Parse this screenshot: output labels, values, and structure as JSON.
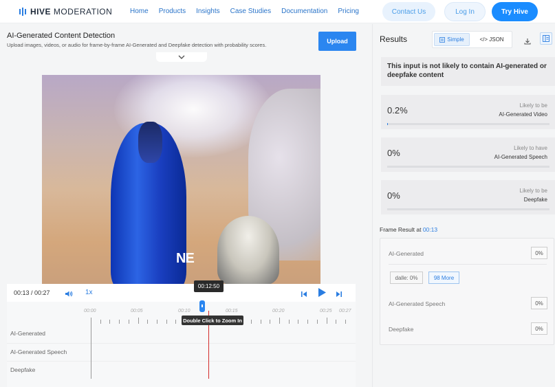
{
  "header": {
    "logo_bold": "HIVE",
    "logo_light": " MODERATION",
    "nav": [
      "Home",
      "Products",
      "Insights",
      "Case Studies",
      "Documentation",
      "Pricing"
    ],
    "contact_label": "Contact Us",
    "login_label": "Log In",
    "try_label": "Try Hive",
    "accent_color": "#1a8cff"
  },
  "left": {
    "title": "AI-Generated Content Detection",
    "subtitle": "Upload images, videos, or audio for frame-by-frame AI-Generated and Deepfake detection with probability scores.",
    "upload_label": "Upload",
    "video_watermark": "NE",
    "player": {
      "time": "00:13 / 00:27",
      "speed": "1x",
      "hover_time": "00:12:50",
      "zoom_hint": "Double Click to Zoom In"
    },
    "timeline": {
      "ticks": [
        "00:00",
        "00:05",
        "00:10",
        "00:15",
        "00:20",
        "00:25",
        "00:27"
      ],
      "rows": [
        "AI-Generated",
        "AI-Generated Speech",
        "Deepfake"
      ]
    }
  },
  "results": {
    "title": "Results",
    "view_simple": "Simple",
    "view_json": "</> JSON",
    "verdict": "This input is not likely to contain AI-generated or deepfake content",
    "metrics": [
      {
        "value": "0.2%",
        "line1": "Likely to be",
        "line2": "AI-Generated Video",
        "fraction": 0.002
      },
      {
        "value": "0%",
        "line1": "Likely to have",
        "line2": "AI-Generated Speech",
        "fraction": 0
      },
      {
        "value": "0%",
        "line1": "Likely to be",
        "line2": "Deepfake",
        "fraction": 0
      }
    ],
    "frame": {
      "title": "Frame Result at ",
      "time": "00:13",
      "ai_label": "AI-Generated",
      "ai_value": "0%",
      "chip_dalle": "dalle: 0%",
      "chip_more": "98 More",
      "speech_label": "AI-Generated Speech",
      "speech_value": "0%",
      "deepfake_label": "Deepfake",
      "deepfake_value": "0%"
    }
  }
}
